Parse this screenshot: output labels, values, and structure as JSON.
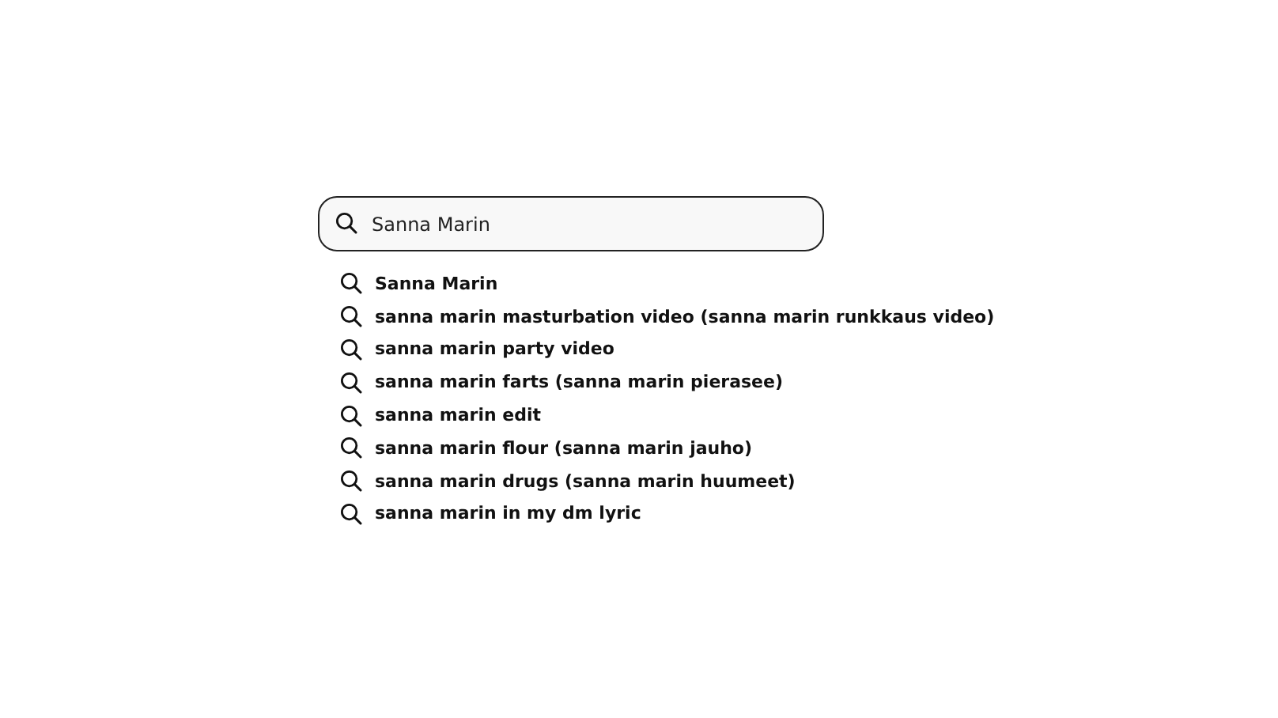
{
  "search": {
    "value": "Sanna Marin"
  },
  "suggestions": [
    {
      "text": "Sanna Marin"
    },
    {
      "text": "sanna marin masturbation video (sanna marin runkkaus video)"
    },
    {
      "text": "sanna marin party video"
    },
    {
      "text": "sanna marin farts (sanna marin pierasee)"
    },
    {
      "text": "sanna marin edit"
    },
    {
      "text": "sanna marin flour (sanna marin jauho)"
    },
    {
      "text": "sanna marin drugs (sanna marin huumeet)"
    },
    {
      "text": "sanna marin in my dm lyric"
    }
  ]
}
